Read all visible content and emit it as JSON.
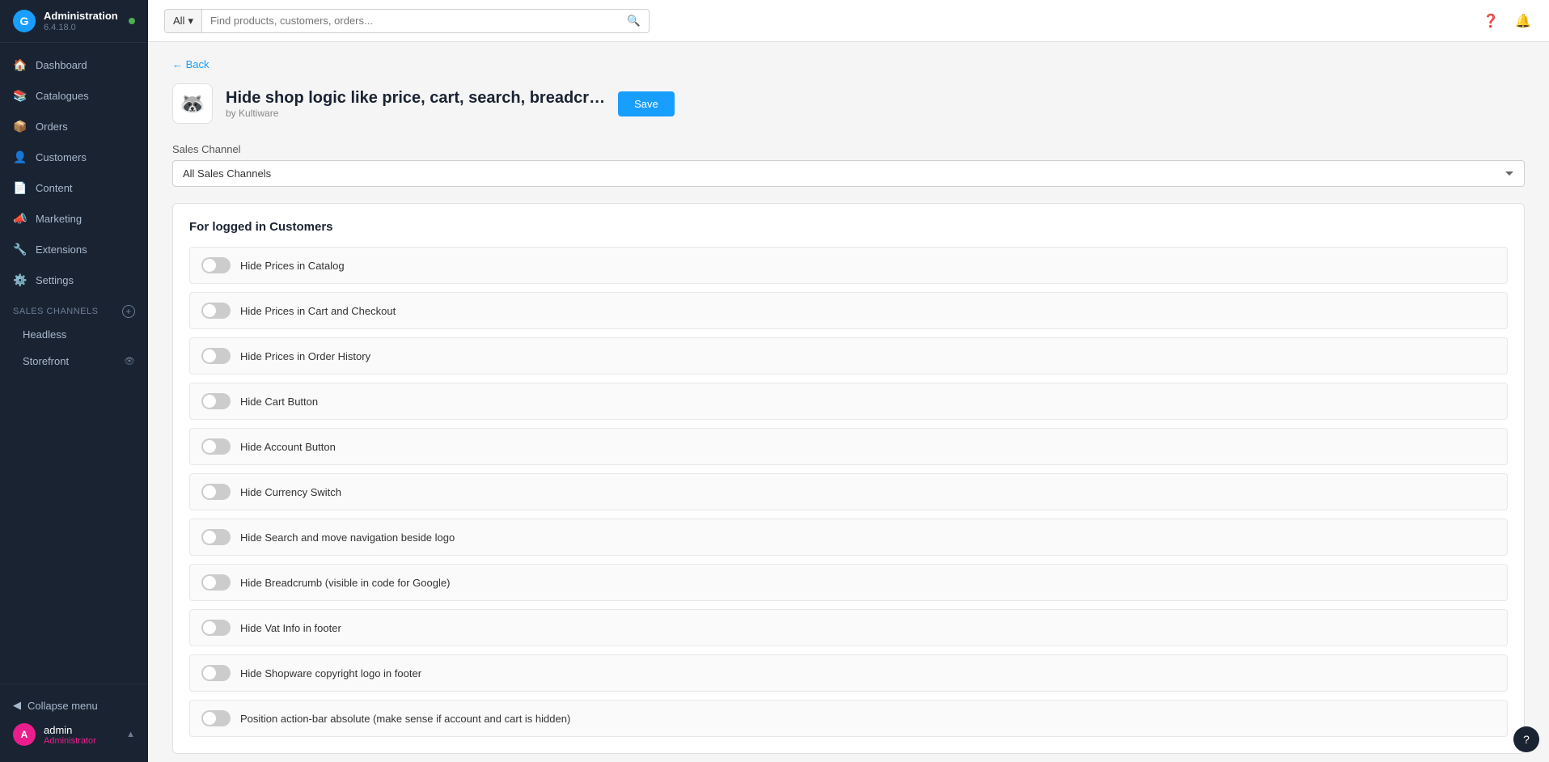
{
  "app": {
    "name": "Administration",
    "version": "6.4.18.0"
  },
  "topbar": {
    "search_placeholder": "Find products, customers, orders...",
    "search_filter": "All"
  },
  "sidebar": {
    "nav_items": [
      {
        "id": "dashboard",
        "label": "Dashboard",
        "icon": "🏠"
      },
      {
        "id": "catalogues",
        "label": "Catalogues",
        "icon": "📚"
      },
      {
        "id": "orders",
        "label": "Orders",
        "icon": "📦"
      },
      {
        "id": "customers",
        "label": "Customers",
        "icon": "👤"
      },
      {
        "id": "content",
        "label": "Content",
        "icon": "📄"
      },
      {
        "id": "marketing",
        "label": "Marketing",
        "icon": "📣"
      },
      {
        "id": "extensions",
        "label": "Extensions",
        "icon": "🔧"
      },
      {
        "id": "settings",
        "label": "Settings",
        "icon": "⚙️"
      }
    ],
    "sales_channels_section": "Sales Channels",
    "sub_items": [
      {
        "id": "headless",
        "label": "Headless"
      },
      {
        "id": "storefront",
        "label": "Storefront"
      }
    ],
    "collapse_label": "Collapse menu",
    "user": {
      "name": "admin",
      "role": "Administrator",
      "initial": "A"
    }
  },
  "page": {
    "back_label": "← Back",
    "plugin": {
      "title": "Hide shop logic like price, cart, search, breadcr…",
      "by": "by Kultiware",
      "emoji": "🦝"
    },
    "save_button": "Save",
    "sales_channel": {
      "label": "Sales Channel",
      "default_option": "All Sales Channels"
    },
    "section": {
      "title": "For logged in Customers",
      "toggles": [
        {
          "id": "hide-prices-catalog",
          "label": "Hide Prices in Catalog",
          "on": false
        },
        {
          "id": "hide-prices-cart",
          "label": "Hide Prices in Cart and Checkout",
          "on": false
        },
        {
          "id": "hide-prices-order-history",
          "label": "Hide Prices in Order History",
          "on": false
        },
        {
          "id": "hide-cart-button",
          "label": "Hide Cart Button",
          "on": false
        },
        {
          "id": "hide-account-button",
          "label": "Hide Account Button",
          "on": false
        },
        {
          "id": "hide-currency-switch",
          "label": "Hide Currency Switch",
          "on": false
        },
        {
          "id": "hide-search-navigation",
          "label": "Hide Search and move navigation beside logo",
          "on": false
        },
        {
          "id": "hide-breadcrumb",
          "label": "Hide Breadcrumb (visible in code for Google)",
          "on": false
        },
        {
          "id": "hide-vat-info",
          "label": "Hide Vat Info in footer",
          "on": false
        },
        {
          "id": "hide-shopware-logo",
          "label": "Hide Shopware copyright logo in footer",
          "on": false
        },
        {
          "id": "position-action-bar",
          "label": "Position action-bar absolute (make sense if account and cart is hidden)",
          "on": false
        }
      ]
    }
  }
}
